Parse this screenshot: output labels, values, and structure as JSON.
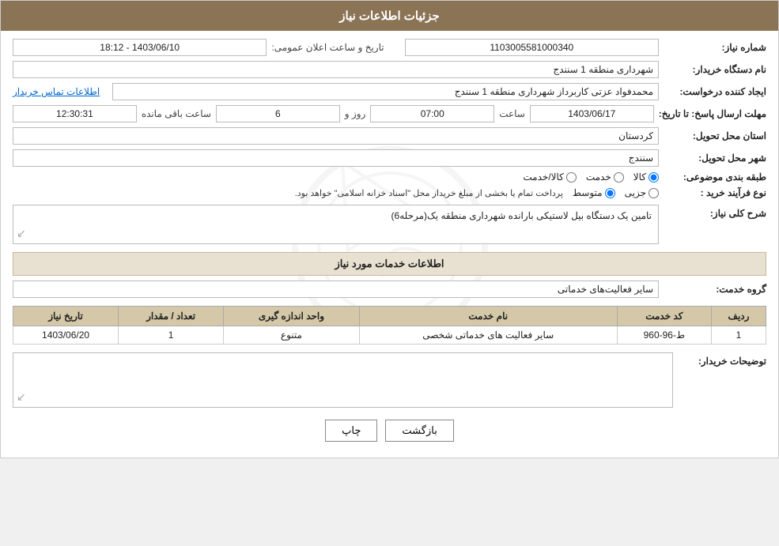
{
  "header": {
    "title": "جزئیات اطلاعات نیاز"
  },
  "fields": {
    "request_number_label": "شماره نیاز:",
    "request_number_value": "1103005581000340",
    "announce_date_label": "تاریخ و ساعت اعلان عمومی:",
    "announce_date_value": "1403/06/10 - 18:12",
    "buyer_org_label": "نام دستگاه خریدار:",
    "buyer_org_value": "شهرداری منطقه 1 سنندج",
    "creator_label": "ایجاد کننده درخواست:",
    "creator_value": "محمدفواد عزتی کاربرداز شهرداری منطقه 1 سنندج",
    "contact_link": "اطلاعات تماس خریدار",
    "deadline_label": "مهلت ارسال پاسخ: تا تاریخ:",
    "deadline_date": "1403/06/17",
    "deadline_time_label": "ساعت",
    "deadline_time": "07:00",
    "deadline_days_label": "روز و",
    "deadline_days": "6",
    "deadline_remaining_label": "ساعت باقی مانده",
    "deadline_remaining": "12:30:31",
    "province_label": "استان محل تحویل:",
    "province_value": "کردستان",
    "city_label": "شهر محل تحویل:",
    "city_value": "سنندج",
    "category_label": "طبقه بندی موضوعی:",
    "category_options": [
      {
        "label": "کالا",
        "value": "kala"
      },
      {
        "label": "خدمت",
        "value": "khedmat"
      },
      {
        "label": "کالا/خدمت",
        "value": "kala_khedmat"
      }
    ],
    "category_selected": "kala",
    "process_label": "نوع فرآیند خرید :",
    "process_options": [
      {
        "label": "جزیی",
        "value": "jozi"
      },
      {
        "label": "متوسط",
        "value": "motavasset"
      }
    ],
    "process_selected": "motavasset",
    "process_note": "پرداخت تمام یا بخشی از مبلغ خریداز محل \"اسناد خزانه اسلامی\" خواهد بود.",
    "description_label": "شرح کلی نیاز:",
    "description_value": "تامین یک دستگاه بیل لاستیکی بارانده شهرداری منطقه یک(مرحله6)",
    "services_info_title": "اطلاعات خدمات مورد نیاز",
    "service_group_label": "گروه خدمت:",
    "service_group_value": "سایر فعالیت‌های خدماتی",
    "table": {
      "headers": [
        "ردیف",
        "کد خدمت",
        "نام خدمت",
        "واحد اندازه گیری",
        "تعداد / مقدار",
        "تاریخ نیاز"
      ],
      "rows": [
        {
          "row": "1",
          "code": "ط-96-960",
          "name": "سایر فعالیت های خدماتی شخصی",
          "unit": "متنوع",
          "qty": "1",
          "date": "1403/06/20"
        }
      ]
    },
    "buyer_desc_label": "توضیحات خریدار:",
    "buyer_desc_value": ""
  },
  "buttons": {
    "print_label": "چاپ",
    "back_label": "بازگشت"
  }
}
